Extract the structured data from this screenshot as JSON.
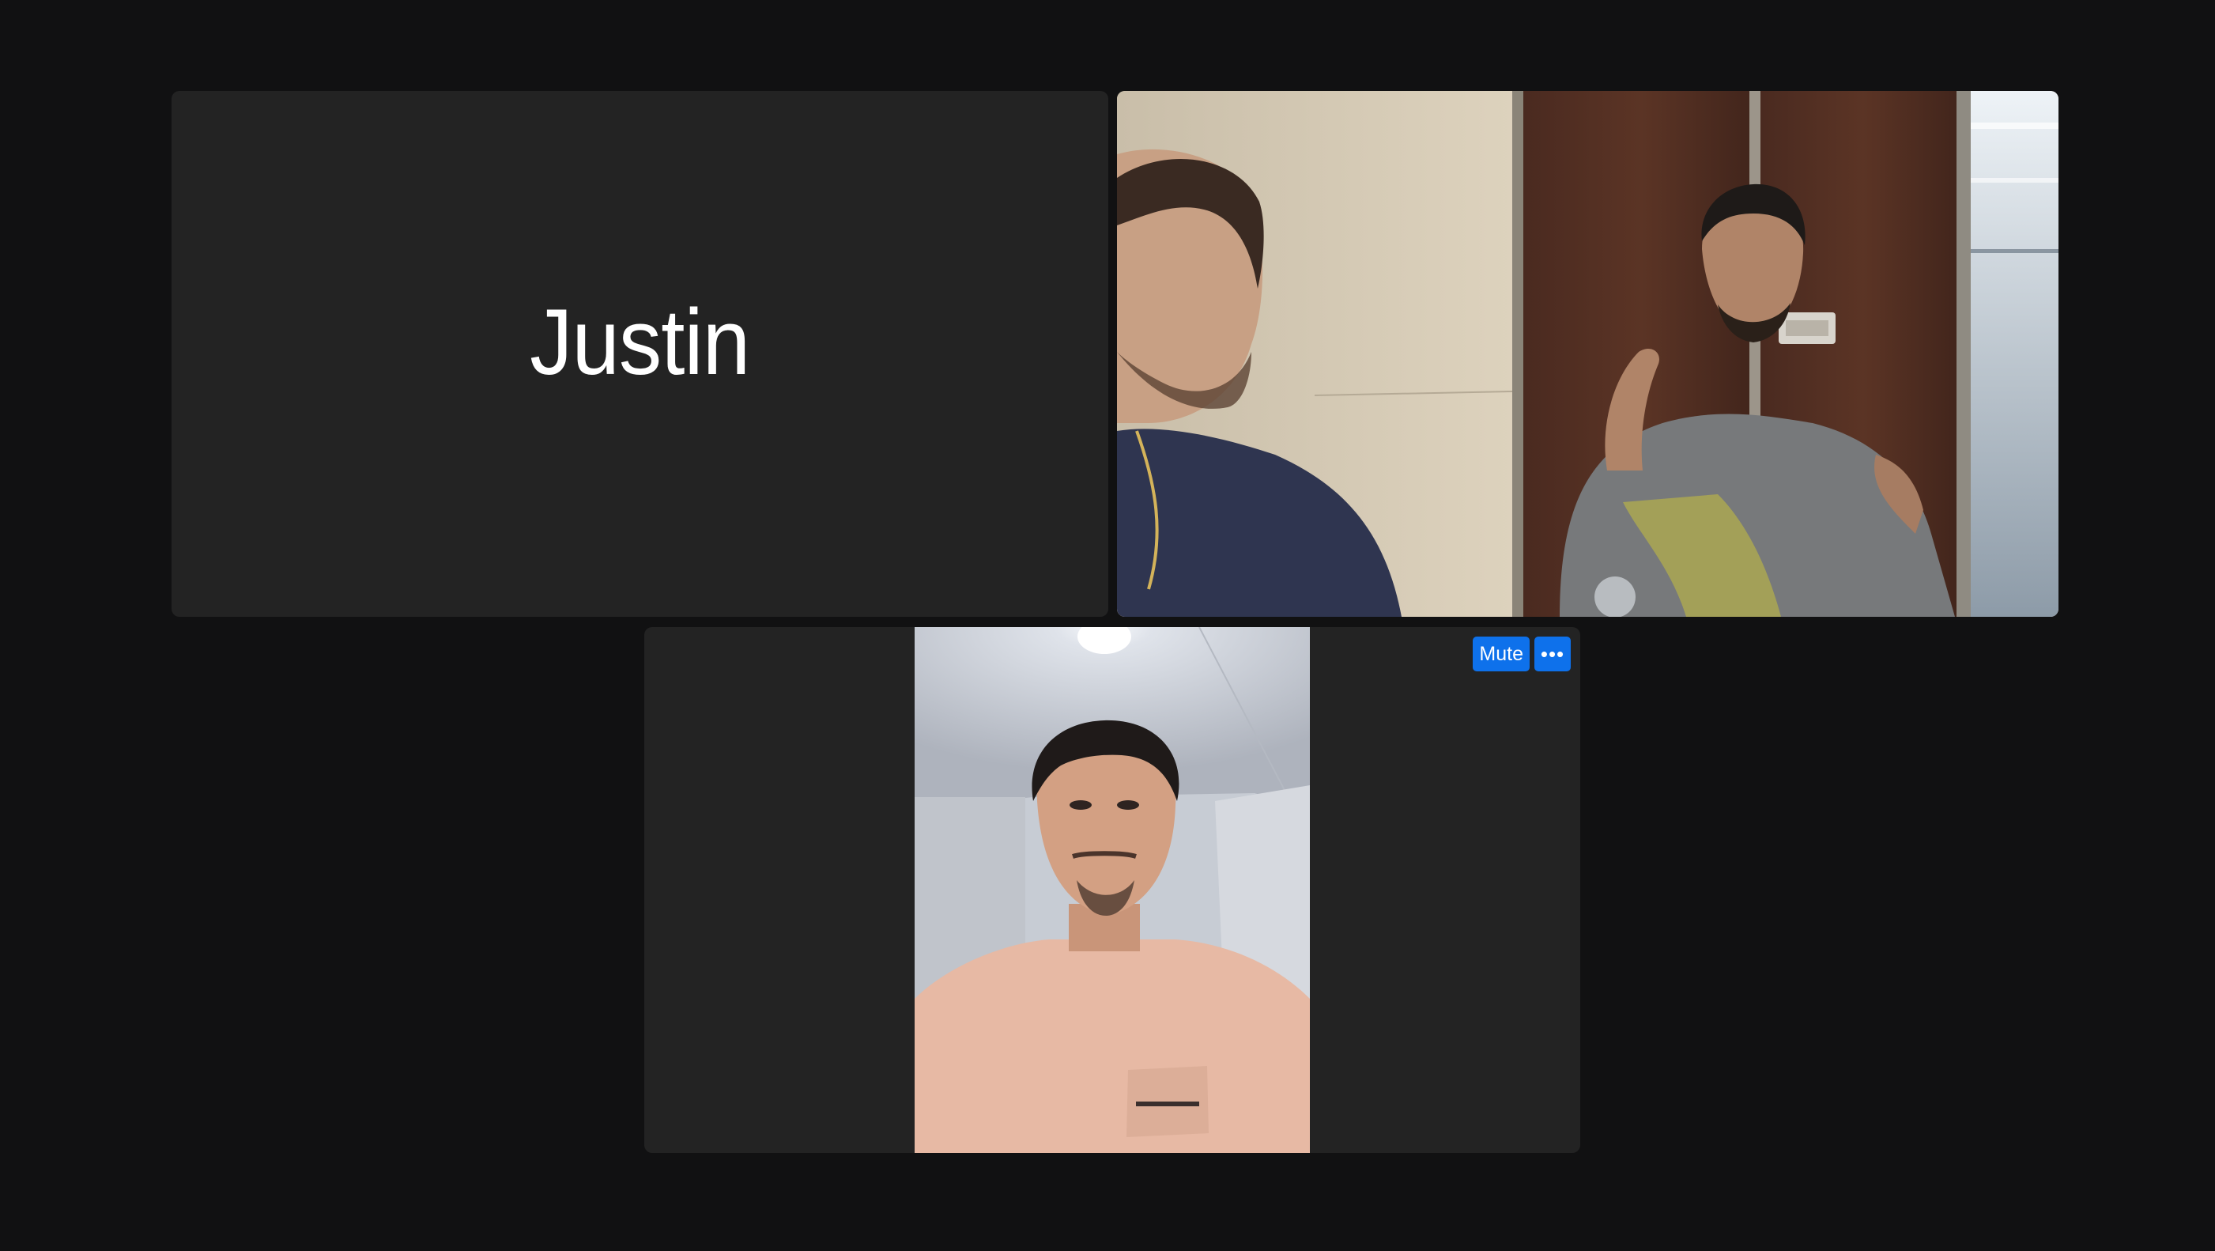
{
  "participants": [
    {
      "name": "Justin",
      "video": false
    },
    {
      "video": true
    },
    {
      "video": true
    }
  ],
  "self_controls": {
    "mute_label": "Mute",
    "more_label": "•••"
  },
  "colors": {
    "background": "#111112",
    "tile": "#232323",
    "button": "#0e71eb"
  }
}
